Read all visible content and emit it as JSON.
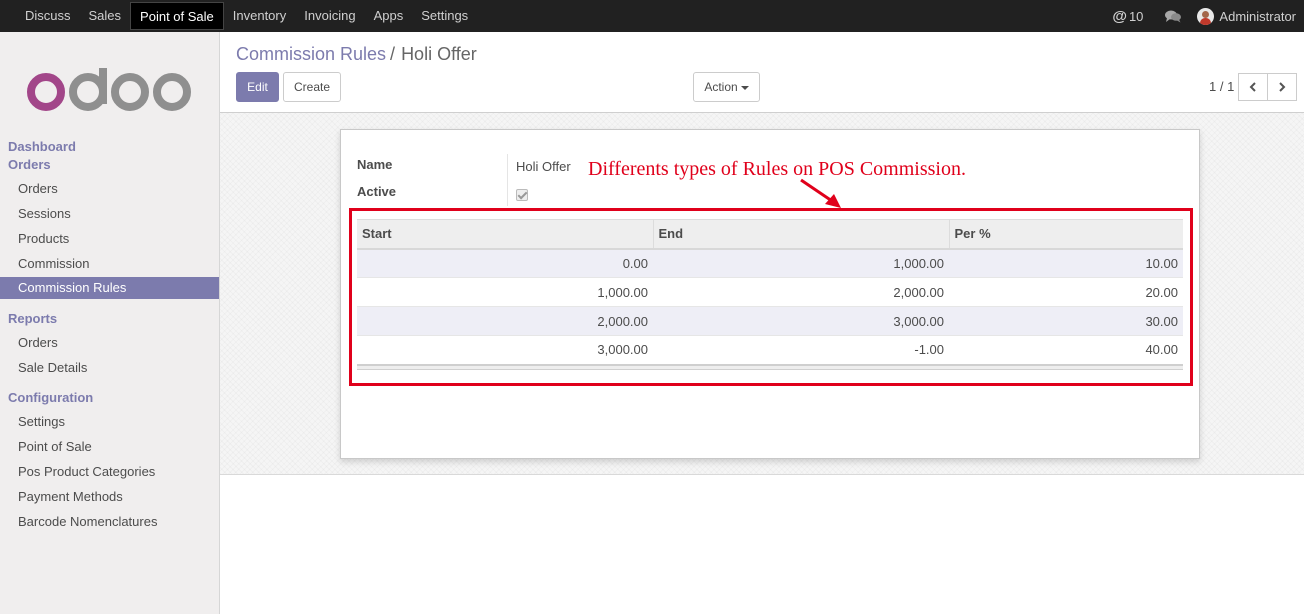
{
  "topbar": {
    "menu": [
      "Discuss",
      "Sales",
      "Point of Sale",
      "Inventory",
      "Invoicing",
      "Apps",
      "Settings"
    ],
    "active_index": 2,
    "mentions_count": "10",
    "user": "Administrator"
  },
  "sidebar": {
    "dashboard": "Dashboard",
    "orders_section": "Orders",
    "orders_items": [
      "Orders",
      "Sessions",
      "Products",
      "Commission",
      "Commission Rules"
    ],
    "reports_section": "Reports",
    "reports_items": [
      "Orders",
      "Sale Details"
    ],
    "config_section": "Configuration",
    "config_items": [
      "Settings",
      "Point of Sale",
      "Pos Product Categories",
      "Payment Methods",
      "Barcode Nomenclatures"
    ],
    "active_item": "Commission Rules"
  },
  "control_panel": {
    "breadcrumb_parent": "Commission Rules",
    "breadcrumb_separator": "/",
    "breadcrumb_current": "Holi Offer",
    "edit_label": "Edit",
    "create_label": "Create",
    "action_label": "Action",
    "pager": "1 / 1"
  },
  "form": {
    "name_label": "Name",
    "name_value": "Holi Offer",
    "active_label": "Active",
    "active_value": true
  },
  "annotation": "Differents types of Rules on POS Commission.",
  "rules_table": {
    "columns": [
      "Start",
      "End",
      "Per %"
    ],
    "rows": [
      [
        "0.00",
        "1,000.00",
        "10.00"
      ],
      [
        "1,000.00",
        "2,000.00",
        "20.00"
      ],
      [
        "2,000.00",
        "3,000.00",
        "30.00"
      ],
      [
        "3,000.00",
        "-1.00",
        "40.00"
      ]
    ]
  },
  "colors": {
    "accent": "#7c7bad",
    "annotation": "#e0001b",
    "topbar": "#212121"
  }
}
